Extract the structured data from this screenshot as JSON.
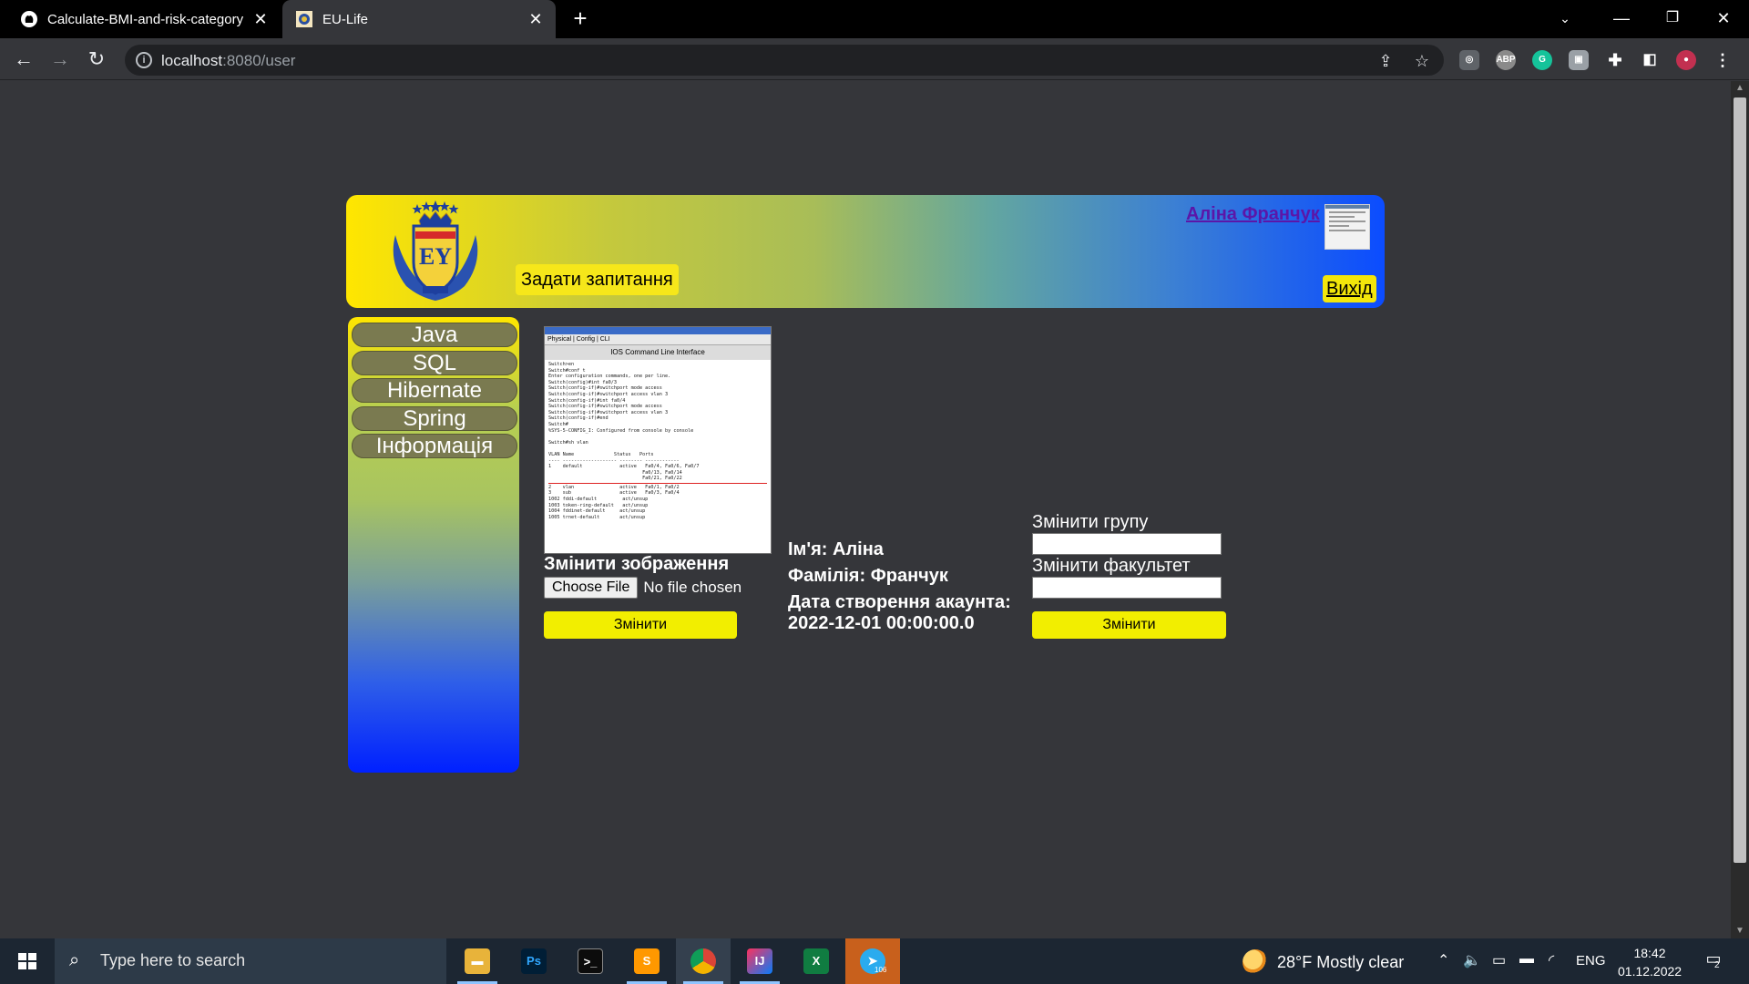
{
  "browser": {
    "tabs": [
      {
        "title": "Calculate-BMI-and-risk-category",
        "icon": "github-icon"
      },
      {
        "title": "EU-Life",
        "icon": "eu-life-favicon"
      }
    ],
    "url": {
      "host": "localhost",
      "path": ":8080/user"
    },
    "new_tab": "+"
  },
  "header": {
    "ask_button": "Задати запитання",
    "user_name": "Аліна Франчук",
    "logout": "Вихід"
  },
  "sidebar": {
    "items": [
      "Java",
      "SQL",
      "Hibernate",
      "Spring",
      "Інформація"
    ]
  },
  "profile": {
    "change_image_label": "Змінити зображення",
    "file_button": "Choose File",
    "file_status": "No file chosen",
    "change_image_button": "Змінити",
    "name_line": "Ім'я: Аліна",
    "surname_line": "Фамілія: Франчук",
    "created_label": "Дата створення акаунта:",
    "created_value": "2022-12-01 00:00:00.0",
    "change_group_label": "Змінити групу",
    "change_faculty_label": "Змінити факультет",
    "change_info_button": "Змінити",
    "screenshot_caption": "IOS Command Line Interface",
    "screenshot_menu": "Physical | Config | CLI"
  },
  "taskbar": {
    "search_placeholder": "Type here to search",
    "weather": "28°F  Mostly clear",
    "language": "ENG",
    "time": "18:42",
    "date": "01.12.2022",
    "notification_count": "2",
    "telegram_badge": "106"
  },
  "colors": {
    "accent_yellow": "#f2ee00",
    "page_bg": "#35363a",
    "link_purple": "#5b16a8"
  }
}
